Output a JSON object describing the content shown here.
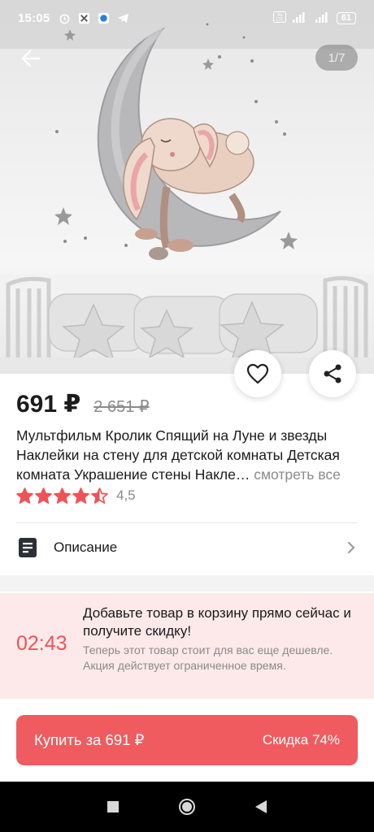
{
  "status_bar": {
    "time": "15:05",
    "battery": "61",
    "icons": [
      "alarm-icon",
      "app-icon",
      "browser-icon",
      "telegram-icon",
      "volte-icon",
      "signal-icon",
      "signal-icon",
      "battery-icon"
    ]
  },
  "gallery": {
    "counter": "1/7"
  },
  "product": {
    "price": "691 ₽",
    "old_price": "2 651 ₽",
    "title": "Мультфильм Кролик Спящий на Луне и звезды Наклейки на стену для детской комнаты Детская комната Украшение стены Накле…",
    "see_all": "смотреть все",
    "rating": 4.5,
    "rating_text": "4,5"
  },
  "description": {
    "label": "Описание"
  },
  "promo": {
    "timer": "02:43",
    "title": "Добавьте товар в корзину прямо сейчас и получите скидку!",
    "subtitle": "Теперь этот товар стоит для вас еще дешевле. Акция действует ограниченное время."
  },
  "buy": {
    "label": "Купить за 691 ₽",
    "discount": "Скидка 74%"
  },
  "colors": {
    "accent": "#ef5b5f",
    "star": "#ef5357",
    "promo_bg": "#fde9e9"
  }
}
